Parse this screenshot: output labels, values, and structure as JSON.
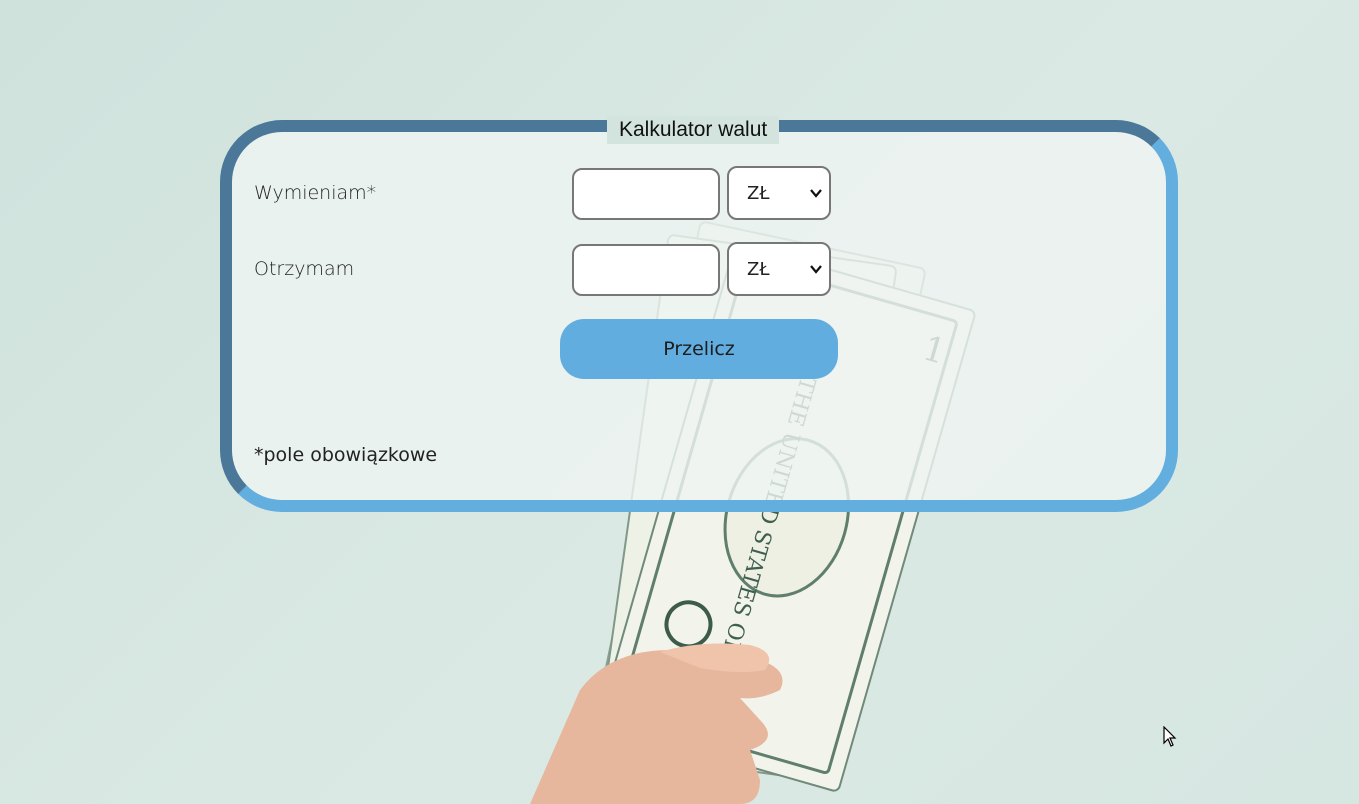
{
  "form": {
    "legend": "Kalkulator walut",
    "exchange_label": "Wymieniam*",
    "exchange_value": "",
    "exchange_currency": "ZŁ",
    "receive_label": "Otrzymam",
    "receive_value": "",
    "receive_currency": "ZŁ",
    "calculate_label": "Przelicz",
    "required_note": "*pole obowiązkowe"
  },
  "colors": {
    "border_dark": "#4b7899",
    "border_light": "#61aedf",
    "button": "#62ade0",
    "background": "#d3e4df"
  },
  "icons": {
    "select_arrow": "chevron-down-icon",
    "cursor": "mouse-pointer-icon"
  }
}
